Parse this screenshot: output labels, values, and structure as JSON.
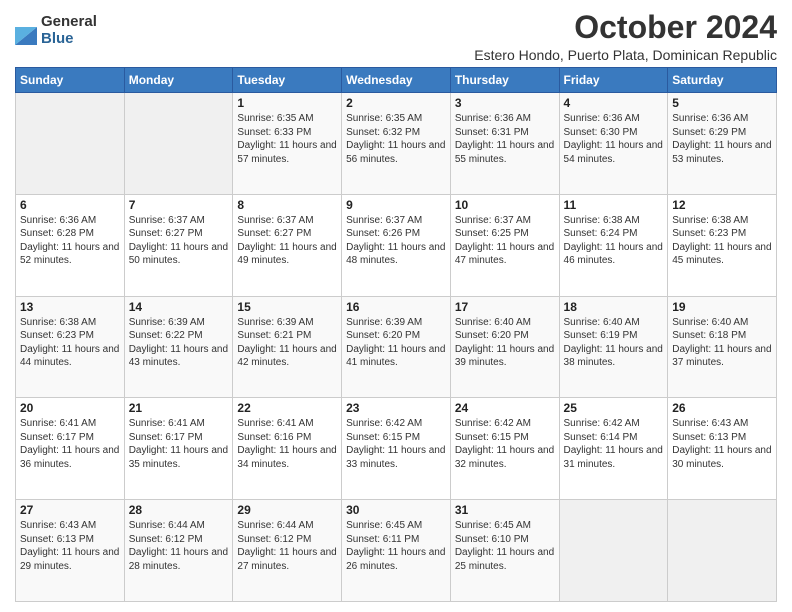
{
  "header": {
    "logo": {
      "general": "General",
      "blue": "Blue"
    },
    "title": "October 2024",
    "subtitle": "Estero Hondo, Puerto Plata, Dominican Republic"
  },
  "calendar": {
    "days_of_week": [
      "Sunday",
      "Monday",
      "Tuesday",
      "Wednesday",
      "Thursday",
      "Friday",
      "Saturday"
    ],
    "weeks": [
      [
        {
          "day": "",
          "info": ""
        },
        {
          "day": "",
          "info": ""
        },
        {
          "day": "1",
          "info": "Sunrise: 6:35 AM\nSunset: 6:33 PM\nDaylight: 11 hours and 57 minutes."
        },
        {
          "day": "2",
          "info": "Sunrise: 6:35 AM\nSunset: 6:32 PM\nDaylight: 11 hours and 56 minutes."
        },
        {
          "day": "3",
          "info": "Sunrise: 6:36 AM\nSunset: 6:31 PM\nDaylight: 11 hours and 55 minutes."
        },
        {
          "day": "4",
          "info": "Sunrise: 6:36 AM\nSunset: 6:30 PM\nDaylight: 11 hours and 54 minutes."
        },
        {
          "day": "5",
          "info": "Sunrise: 6:36 AM\nSunset: 6:29 PM\nDaylight: 11 hours and 53 minutes."
        }
      ],
      [
        {
          "day": "6",
          "info": "Sunrise: 6:36 AM\nSunset: 6:28 PM\nDaylight: 11 hours and 52 minutes."
        },
        {
          "day": "7",
          "info": "Sunrise: 6:37 AM\nSunset: 6:27 PM\nDaylight: 11 hours and 50 minutes."
        },
        {
          "day": "8",
          "info": "Sunrise: 6:37 AM\nSunset: 6:27 PM\nDaylight: 11 hours and 49 minutes."
        },
        {
          "day": "9",
          "info": "Sunrise: 6:37 AM\nSunset: 6:26 PM\nDaylight: 11 hours and 48 minutes."
        },
        {
          "day": "10",
          "info": "Sunrise: 6:37 AM\nSunset: 6:25 PM\nDaylight: 11 hours and 47 minutes."
        },
        {
          "day": "11",
          "info": "Sunrise: 6:38 AM\nSunset: 6:24 PM\nDaylight: 11 hours and 46 minutes."
        },
        {
          "day": "12",
          "info": "Sunrise: 6:38 AM\nSunset: 6:23 PM\nDaylight: 11 hours and 45 minutes."
        }
      ],
      [
        {
          "day": "13",
          "info": "Sunrise: 6:38 AM\nSunset: 6:23 PM\nDaylight: 11 hours and 44 minutes."
        },
        {
          "day": "14",
          "info": "Sunrise: 6:39 AM\nSunset: 6:22 PM\nDaylight: 11 hours and 43 minutes."
        },
        {
          "day": "15",
          "info": "Sunrise: 6:39 AM\nSunset: 6:21 PM\nDaylight: 11 hours and 42 minutes."
        },
        {
          "day": "16",
          "info": "Sunrise: 6:39 AM\nSunset: 6:20 PM\nDaylight: 11 hours and 41 minutes."
        },
        {
          "day": "17",
          "info": "Sunrise: 6:40 AM\nSunset: 6:20 PM\nDaylight: 11 hours and 39 minutes."
        },
        {
          "day": "18",
          "info": "Sunrise: 6:40 AM\nSunset: 6:19 PM\nDaylight: 11 hours and 38 minutes."
        },
        {
          "day": "19",
          "info": "Sunrise: 6:40 AM\nSunset: 6:18 PM\nDaylight: 11 hours and 37 minutes."
        }
      ],
      [
        {
          "day": "20",
          "info": "Sunrise: 6:41 AM\nSunset: 6:17 PM\nDaylight: 11 hours and 36 minutes."
        },
        {
          "day": "21",
          "info": "Sunrise: 6:41 AM\nSunset: 6:17 PM\nDaylight: 11 hours and 35 minutes."
        },
        {
          "day": "22",
          "info": "Sunrise: 6:41 AM\nSunset: 6:16 PM\nDaylight: 11 hours and 34 minutes."
        },
        {
          "day": "23",
          "info": "Sunrise: 6:42 AM\nSunset: 6:15 PM\nDaylight: 11 hours and 33 minutes."
        },
        {
          "day": "24",
          "info": "Sunrise: 6:42 AM\nSunset: 6:15 PM\nDaylight: 11 hours and 32 minutes."
        },
        {
          "day": "25",
          "info": "Sunrise: 6:42 AM\nSunset: 6:14 PM\nDaylight: 11 hours and 31 minutes."
        },
        {
          "day": "26",
          "info": "Sunrise: 6:43 AM\nSunset: 6:13 PM\nDaylight: 11 hours and 30 minutes."
        }
      ],
      [
        {
          "day": "27",
          "info": "Sunrise: 6:43 AM\nSunset: 6:13 PM\nDaylight: 11 hours and 29 minutes."
        },
        {
          "day": "28",
          "info": "Sunrise: 6:44 AM\nSunset: 6:12 PM\nDaylight: 11 hours and 28 minutes."
        },
        {
          "day": "29",
          "info": "Sunrise: 6:44 AM\nSunset: 6:12 PM\nDaylight: 11 hours and 27 minutes."
        },
        {
          "day": "30",
          "info": "Sunrise: 6:45 AM\nSunset: 6:11 PM\nDaylight: 11 hours and 26 minutes."
        },
        {
          "day": "31",
          "info": "Sunrise: 6:45 AM\nSunset: 6:10 PM\nDaylight: 11 hours and 25 minutes."
        },
        {
          "day": "",
          "info": ""
        },
        {
          "day": "",
          "info": ""
        }
      ]
    ]
  }
}
